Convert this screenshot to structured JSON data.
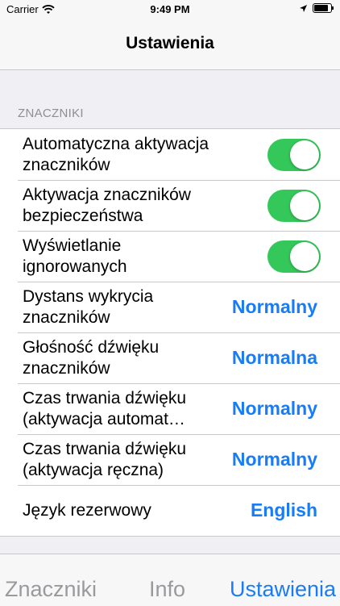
{
  "status": {
    "carrier": "Carrier",
    "time": "9:49 PM",
    "battery_level": 0.85
  },
  "nav": {
    "title": "Ustawienia"
  },
  "section": {
    "header": "ZNACZNIKI"
  },
  "rows": [
    {
      "label": "Automatyczna aktywacja znaczników",
      "type": "switch",
      "on": true
    },
    {
      "label": "Aktywacja znaczników bezpieczeństwa",
      "type": "switch",
      "on": true
    },
    {
      "label": "Wyświetlanie ignorowanych",
      "type": "switch",
      "on": true
    },
    {
      "label": "Dystans wykrycia znaczników",
      "type": "value",
      "value": "Normalny"
    },
    {
      "label": "Głośność dźwięku znaczników",
      "type": "value",
      "value": "Normalna"
    },
    {
      "label": "Czas trwania dźwięku (aktywacja automat…",
      "type": "value",
      "value": "Normalny"
    },
    {
      "label": "Czas trwania dźwięku (aktywacja ręczna)",
      "type": "value",
      "value": "Normalny"
    },
    {
      "label": "Język rezerwowy",
      "type": "value",
      "value": "English"
    }
  ],
  "tabs": [
    {
      "label": "Znaczniki",
      "active": false
    },
    {
      "label": "Info",
      "active": false
    },
    {
      "label": "Ustawienia",
      "active": true
    }
  ],
  "colors": {
    "accent": "#1a7cf5",
    "switch_on": "#34c759"
  }
}
